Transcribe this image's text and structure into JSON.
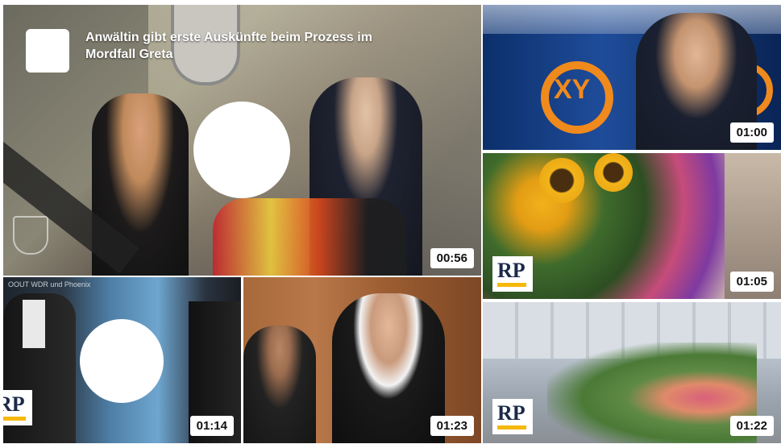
{
  "main_video": {
    "title": "Anwältin gibt erste Auskünfte beim Prozess im Mordfall Greta",
    "duration": "00:56"
  },
  "thumbnails": [
    {
      "id": "xy-studio",
      "duration": "01:00",
      "logo": "XY"
    },
    {
      "id": "flowers-memorial",
      "duration": "01:05",
      "logo": "RP"
    },
    {
      "id": "courtroom-wdr",
      "duration": "01:14",
      "caption": "OOUT WDR und Phoenix",
      "logo": "RP"
    },
    {
      "id": "defendant-court",
      "duration": "01:23"
    },
    {
      "id": "tulips-street",
      "duration": "01:22",
      "logo": "RP"
    }
  ],
  "colors": {
    "accent": "#f5b90a",
    "xy_orange": "#f08a1c",
    "rp_navy": "#1c2a4a"
  }
}
